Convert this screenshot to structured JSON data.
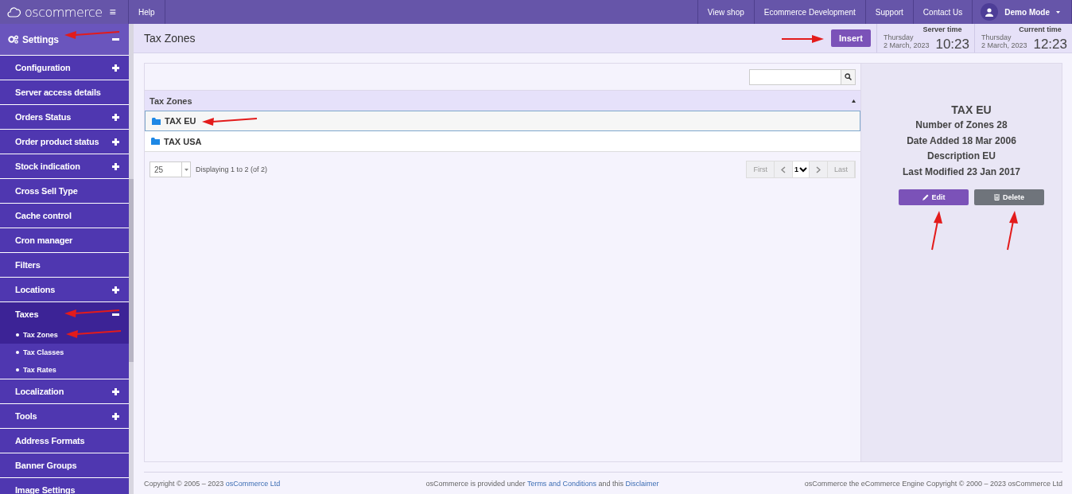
{
  "topbar": {
    "logo": "oscommerce",
    "menu_icon": "≡",
    "help": "Help",
    "links": [
      "View shop",
      "Ecommerce Development",
      "Support",
      "Contact Us"
    ],
    "user": "Demo Mode"
  },
  "sidebar": {
    "header": {
      "label": "Settings",
      "expanded": true,
      "arrow": true
    },
    "items": [
      {
        "label": "Configuration",
        "expanded": false
      },
      {
        "label": "Server access details"
      },
      {
        "label": "Orders Status",
        "expanded": false
      },
      {
        "label": "Order product status",
        "expanded": false
      },
      {
        "label": "Stock indication",
        "expanded": false
      },
      {
        "label": "Cross Sell Type"
      },
      {
        "label": "Cache control"
      },
      {
        "label": "Cron manager"
      },
      {
        "label": "Filters"
      },
      {
        "label": "Locations",
        "expanded": false
      },
      {
        "label": "Taxes",
        "expanded": true,
        "arrow": true,
        "children": [
          {
            "label": "Tax Zones",
            "selected": true,
            "arrow": true
          },
          {
            "label": "Tax Classes",
            "selected": false
          },
          {
            "label": "Tax Rates",
            "selected": false
          }
        ]
      },
      {
        "label": "Localization",
        "expanded": false
      },
      {
        "label": "Tools",
        "expanded": false
      },
      {
        "label": "Address Formats"
      },
      {
        "label": "Banner Groups"
      },
      {
        "label": "Image Settings"
      }
    ]
  },
  "header": {
    "title": "Tax Zones",
    "insert": {
      "label": "Insert",
      "arrow": true
    },
    "clocks": [
      {
        "title": "Server time",
        "day": "Thursday",
        "date": "2 March, 2023",
        "time": "10:23"
      },
      {
        "title": "Current time",
        "day": "Thursday",
        "date": "2 March, 2023",
        "time": "12:23"
      }
    ]
  },
  "table": {
    "column": "Tax Zones",
    "rows": [
      {
        "name": "TAX EU",
        "selected": true,
        "arrow": true
      },
      {
        "name": "TAX USA",
        "selected": false
      }
    ],
    "page_size": "25",
    "displaying": "Displaying 1 to 2 (of 2)",
    "pager": {
      "first": "First",
      "page": "1",
      "last": "Last"
    }
  },
  "details": {
    "title": "TAX EU",
    "fields": [
      {
        "label": "Number of Zones",
        "value": "28"
      },
      {
        "label": "Date Added",
        "value": "18 Mar 2006"
      },
      {
        "label": "Description",
        "value": "EU"
      },
      {
        "label": "Last Modified",
        "value": "23 Jan 2017"
      }
    ],
    "buttons": [
      {
        "kind": "edit",
        "label": "Edit",
        "arrow": true
      },
      {
        "kind": "delete",
        "label": "Delete",
        "arrow": true
      }
    ]
  },
  "footer": {
    "left": "Copyright © 2005 – 2023 ",
    "left_link": "osCommerce Ltd",
    "mid_1": "osCommerce is provided under ",
    "mid_link_1": "Terms and Conditions",
    "mid_2": " and this ",
    "mid_link_2": "Disclaimer",
    "right": "osCommerce the eCommerce Engine Copyright © 2000 – 2023 osCommerce Ltd"
  }
}
